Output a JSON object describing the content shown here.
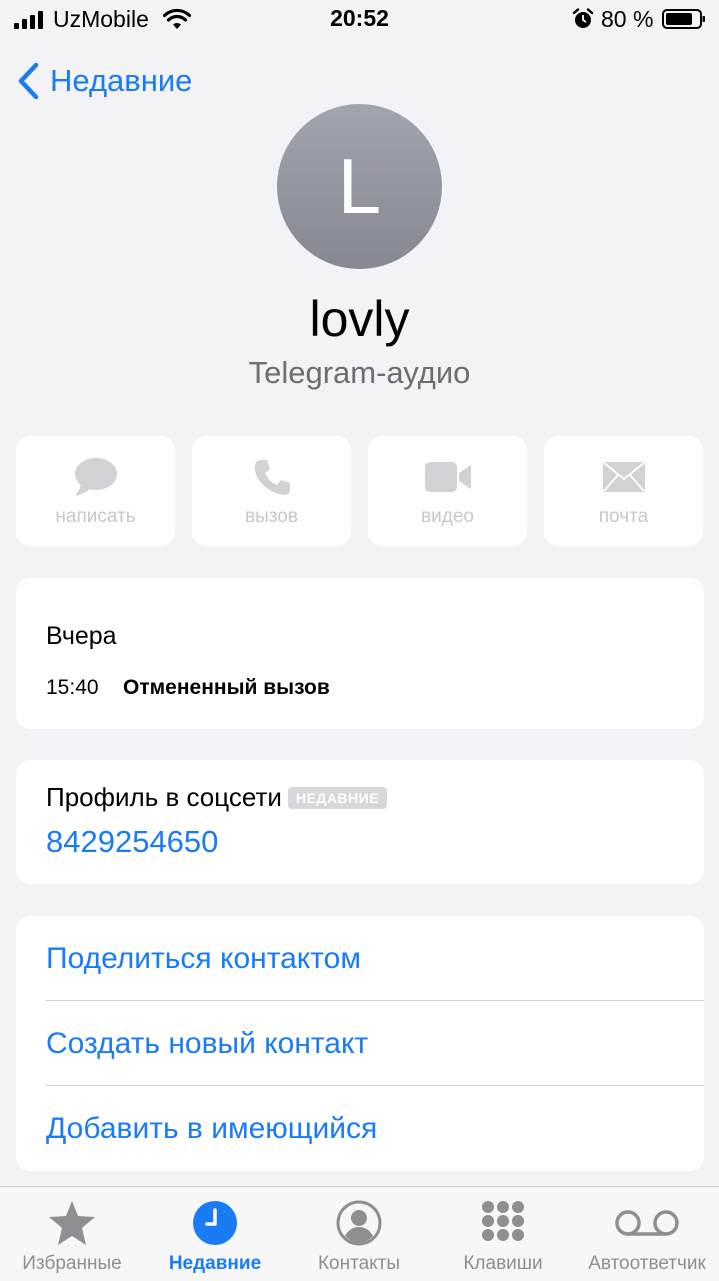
{
  "status_bar": {
    "carrier": "UzMobile",
    "time": "20:52",
    "battery": "80 %"
  },
  "nav": {
    "back_label": "Недавние"
  },
  "contact": {
    "initial": "L",
    "name": "lovly",
    "subtitle": "Telegram-аудио"
  },
  "actions": [
    {
      "label": "написать",
      "icon": "message-icon"
    },
    {
      "label": "вызов",
      "icon": "phone-icon"
    },
    {
      "label": "видео",
      "icon": "video-icon"
    },
    {
      "label": "почта",
      "icon": "mail-icon"
    }
  ],
  "call_history": {
    "day": "Вчера",
    "time": "15:40",
    "status": "Отмененный вызов"
  },
  "social_profile": {
    "label": "Профиль в соцсети",
    "badge": "НЕДАВНИЕ",
    "value": "8429254650"
  },
  "options": [
    "Поделиться контактом",
    "Создать новый контакт",
    "Добавить в имеющийся"
  ],
  "tabs": [
    {
      "label": "Избранные",
      "icon": "star-icon",
      "active": false
    },
    {
      "label": "Недавние",
      "icon": "clock-icon",
      "active": true
    },
    {
      "label": "Контакты",
      "icon": "person-icon",
      "active": false
    },
    {
      "label": "Клавиши",
      "icon": "keypad-icon",
      "active": false
    },
    {
      "label": "Автоответчик",
      "icon": "voicemail-icon",
      "active": false
    }
  ],
  "colors": {
    "accent": "#1a7cf5",
    "background": "#f2f2f7",
    "disabled": "#c7c7cc",
    "tab_inactive": "#8e8e93"
  }
}
